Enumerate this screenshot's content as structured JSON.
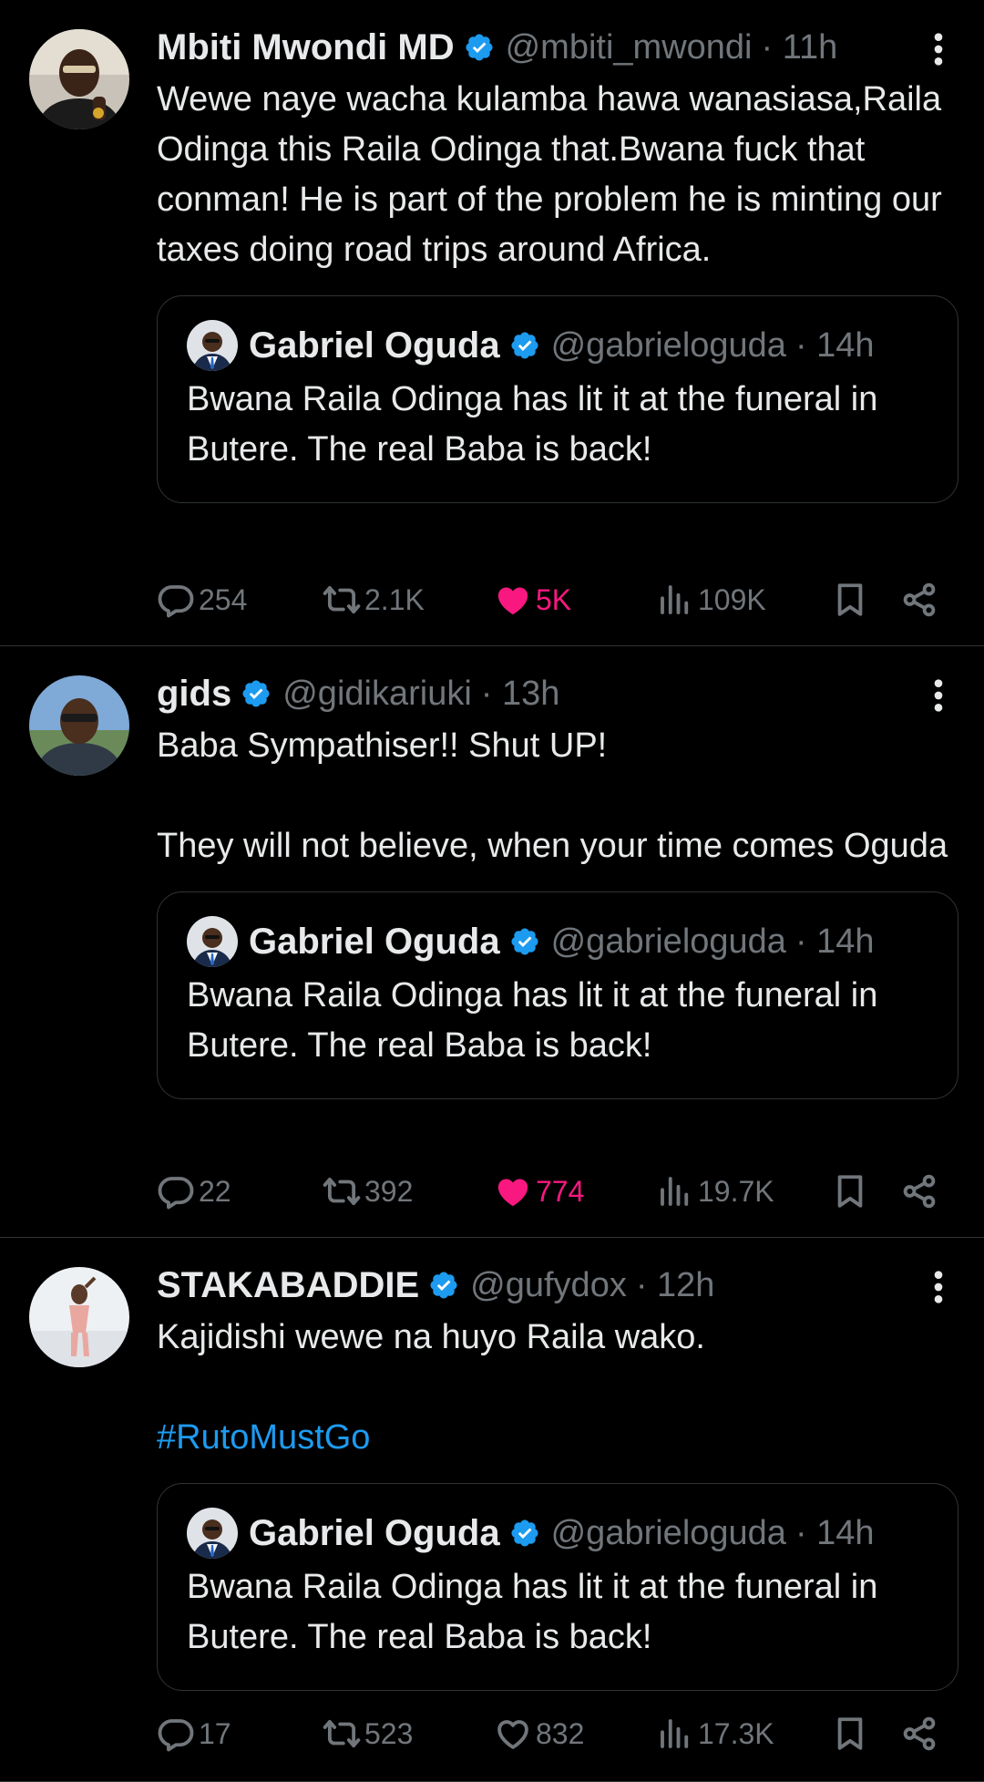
{
  "tweets": [
    {
      "name": "Mbiti Mwondi MD",
      "handle": "@mbiti_mwondi",
      "time": "· 11h",
      "text": "Wewe naye wacha kulamba hawa wanasiasa,Raila Odinga this Raila Odinga that.Bwana fuck that conman! He is part of the problem he is minting our taxes doing road trips around Africa.",
      "quote": {
        "name": "Gabriel Oguda",
        "handle": "@gabrieloguda",
        "time": "· 14h",
        "text": "Bwana Raila Odinga has lit it at the funeral in Butere. The real Baba is back!"
      },
      "stats": {
        "replies": "254",
        "reposts": "2.1K",
        "likes": "5K",
        "views": "109K"
      },
      "liked": true
    },
    {
      "name": "gids",
      "handle": "@gidikariuki",
      "time": "· 13h",
      "text": "Baba Sympathiser!! Shut UP!\n\nThey will not believe, when your time comes Oguda",
      "quote": {
        "name": "Gabriel Oguda",
        "handle": "@gabrieloguda",
        "time": "· 14h",
        "text": "Bwana Raila Odinga has lit it at the funeral in Butere. The real Baba is back!"
      },
      "stats": {
        "replies": "22",
        "reposts": "392",
        "likes": "774",
        "views": "19.7K"
      },
      "liked": true
    },
    {
      "name": "STAKABADDIE",
      "handle": "@gufydox",
      "time": "· 12h",
      "text": "Kajidishi wewe na huyo Raila wako.",
      "hashtag": "#RutoMustGo",
      "quote": {
        "name": "Gabriel Oguda",
        "handle": "@gabrieloguda",
        "time": "· 14h",
        "text": "Bwana Raila Odinga has lit it at the funeral in Butere. The real Baba is back!"
      },
      "stats": {
        "replies": "17",
        "reposts": "523",
        "likes": "832",
        "views": "17.3K"
      },
      "liked": false
    }
  ],
  "colors": {
    "background": "#000000",
    "text": "#e7e9ea",
    "secondary": "#71767b",
    "verified": "#1d9bf0",
    "like": "#f91880",
    "border": "#2f3336"
  }
}
